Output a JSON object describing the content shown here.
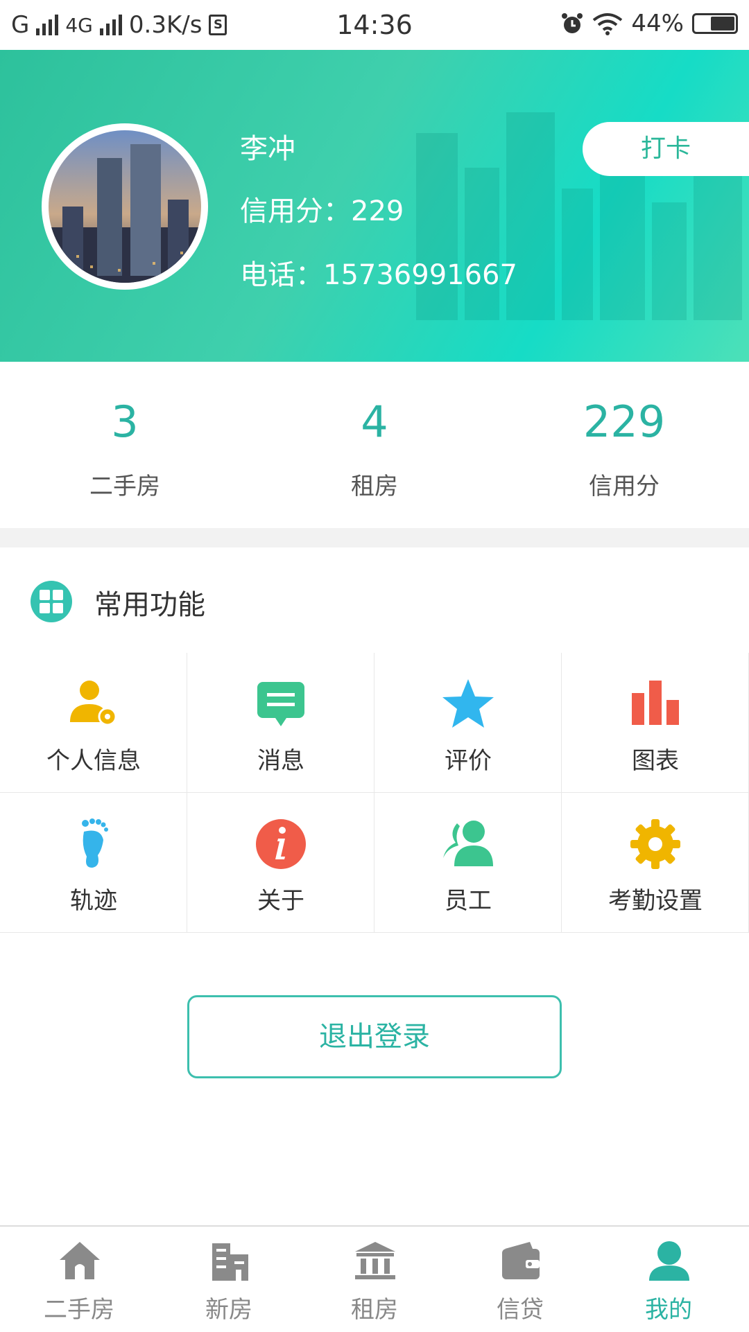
{
  "status_bar": {
    "carrier1": "G",
    "carrier2": "4G",
    "speed": "0.3K/s",
    "time": "14:36",
    "battery": "44%"
  },
  "profile": {
    "name": "李冲",
    "credit_line": "信用分：229",
    "phone_line": "电话：15736991667",
    "punch_label": "打卡"
  },
  "stats": [
    {
      "value": "3",
      "label": "二手房"
    },
    {
      "value": "4",
      "label": "租房"
    },
    {
      "value": "229",
      "label": "信用分"
    }
  ],
  "section": {
    "title": "常用功能",
    "icon": "grid-icon"
  },
  "functions": [
    {
      "label": "个人信息",
      "icon": "user-settings-icon",
      "color": "#f0b500"
    },
    {
      "label": "消息",
      "icon": "message-icon",
      "color": "#3cc58f"
    },
    {
      "label": "评价",
      "icon": "star-icon",
      "color": "#31b6ee"
    },
    {
      "label": "图表",
      "icon": "bar-chart-icon",
      "color": "#f05c49"
    },
    {
      "label": "轨迹",
      "icon": "footprint-icon",
      "color": "#35b4ea"
    },
    {
      "label": "关于",
      "icon": "info-icon",
      "color": "#f05c49"
    },
    {
      "label": "员工",
      "icon": "staff-icon",
      "color": "#3cc58f"
    },
    {
      "label": "考勤设置",
      "icon": "gear-icon",
      "color": "#f0b500"
    }
  ],
  "logout_label": "退出登录",
  "nav": [
    {
      "label": "二手房",
      "icon": "home-icon",
      "active": false
    },
    {
      "label": "新房",
      "icon": "buildings-icon",
      "active": false
    },
    {
      "label": "租房",
      "icon": "bank-icon",
      "active": false
    },
    {
      "label": "信贷",
      "icon": "wallet-icon",
      "active": false
    },
    {
      "label": "我的",
      "icon": "person-icon",
      "active": true
    }
  ],
  "colors": {
    "accent": "#2bb3a3",
    "header_start": "#2dc19c",
    "header_end": "#16dcc6",
    "nav_inactive": "#888888"
  }
}
